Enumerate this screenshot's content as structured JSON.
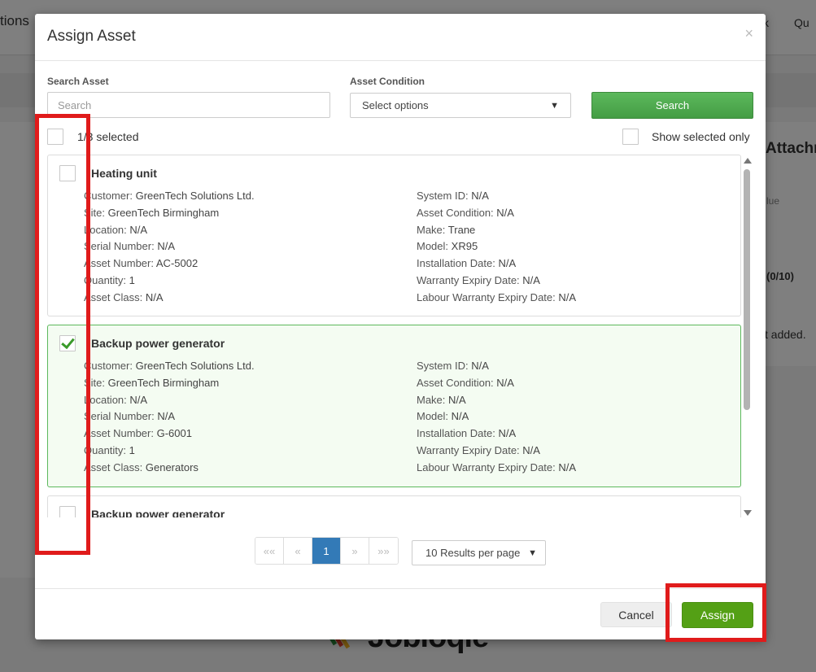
{
  "background": {
    "tab_left": "tions",
    "tab_k": "k",
    "tab_qu": "Qu",
    "attachments_heading": "Attachr",
    "value_label": "lue",
    "count_label": "(0/10)",
    "not_added_text": "t added.",
    "logo_text": "Jobloqie"
  },
  "modal": {
    "title": "Assign Asset",
    "close_label": "×",
    "search": {
      "label": "Search Asset",
      "placeholder": "Search",
      "value": ""
    },
    "condition": {
      "label": "Asset Condition",
      "selected": "Select options"
    },
    "search_button": "Search",
    "selection_count": "1/3 selected",
    "show_selected_only": "Show selected only",
    "assets": [
      {
        "name": "Heating unit",
        "checked": false,
        "left": [
          {
            "k": "Customer:",
            "v": "GreenTech Solutions Ltd."
          },
          {
            "k": "Site:",
            "v": "GreenTech Birmingham"
          },
          {
            "k": "Location:",
            "v": "N/A"
          },
          {
            "k": "Serial Number:",
            "v": "N/A"
          },
          {
            "k": "Asset Number:",
            "v": "AC-5002"
          },
          {
            "k": "Quantity:",
            "v": "1"
          },
          {
            "k": "Asset Class:",
            "v": "N/A"
          }
        ],
        "right": [
          {
            "k": "System ID:",
            "v": "N/A"
          },
          {
            "k": "Asset Condition:",
            "v": "N/A"
          },
          {
            "k": "Make:",
            "v": "Trane"
          },
          {
            "k": "Model:",
            "v": "XR95"
          },
          {
            "k": "Installation Date:",
            "v": "N/A"
          },
          {
            "k": "Warranty Expiry Date:",
            "v": "N/A"
          },
          {
            "k": "Labour Warranty Expiry Date:",
            "v": "N/A"
          }
        ]
      },
      {
        "name": "Backup power generator",
        "checked": true,
        "left": [
          {
            "k": "Customer:",
            "v": "GreenTech Solutions Ltd."
          },
          {
            "k": "Site:",
            "v": "GreenTech Birmingham"
          },
          {
            "k": "Location:",
            "v": "N/A"
          },
          {
            "k": "Serial Number:",
            "v": "N/A"
          },
          {
            "k": "Asset Number:",
            "v": "G-6001"
          },
          {
            "k": "Quantity:",
            "v": "1"
          },
          {
            "k": "Asset Class:",
            "v": "Generators"
          }
        ],
        "right": [
          {
            "k": "System ID:",
            "v": "N/A"
          },
          {
            "k": "Asset Condition:",
            "v": "N/A"
          },
          {
            "k": "Make:",
            "v": "N/A"
          },
          {
            "k": "Model:",
            "v": "N/A"
          },
          {
            "k": "Installation Date:",
            "v": "N/A"
          },
          {
            "k": "Warranty Expiry Date:",
            "v": "N/A"
          },
          {
            "k": "Labour Warranty Expiry Date:",
            "v": "N/A"
          }
        ]
      },
      {
        "name": "Backup power generator",
        "checked": false
      }
    ],
    "pagination": {
      "first": "««",
      "prev": "«",
      "current": "1",
      "next": "»",
      "last": "»»"
    },
    "per_page": "10 Results per page",
    "cancel_button": "Cancel",
    "assign_button": "Assign"
  },
  "colors": {
    "primary_green": "#5cb85c",
    "assign_green": "#54a015",
    "active_page_blue": "#337ab7",
    "highlight_red": "#e01b1b",
    "selected_card_bg": "#f4fcf2"
  },
  "icons": {
    "close": "close-icon",
    "select_chevron": "chevron-down-icon",
    "scroll_up": "arrow-up-icon",
    "scroll_down": "arrow-down-icon",
    "check": "checkmark-icon"
  }
}
